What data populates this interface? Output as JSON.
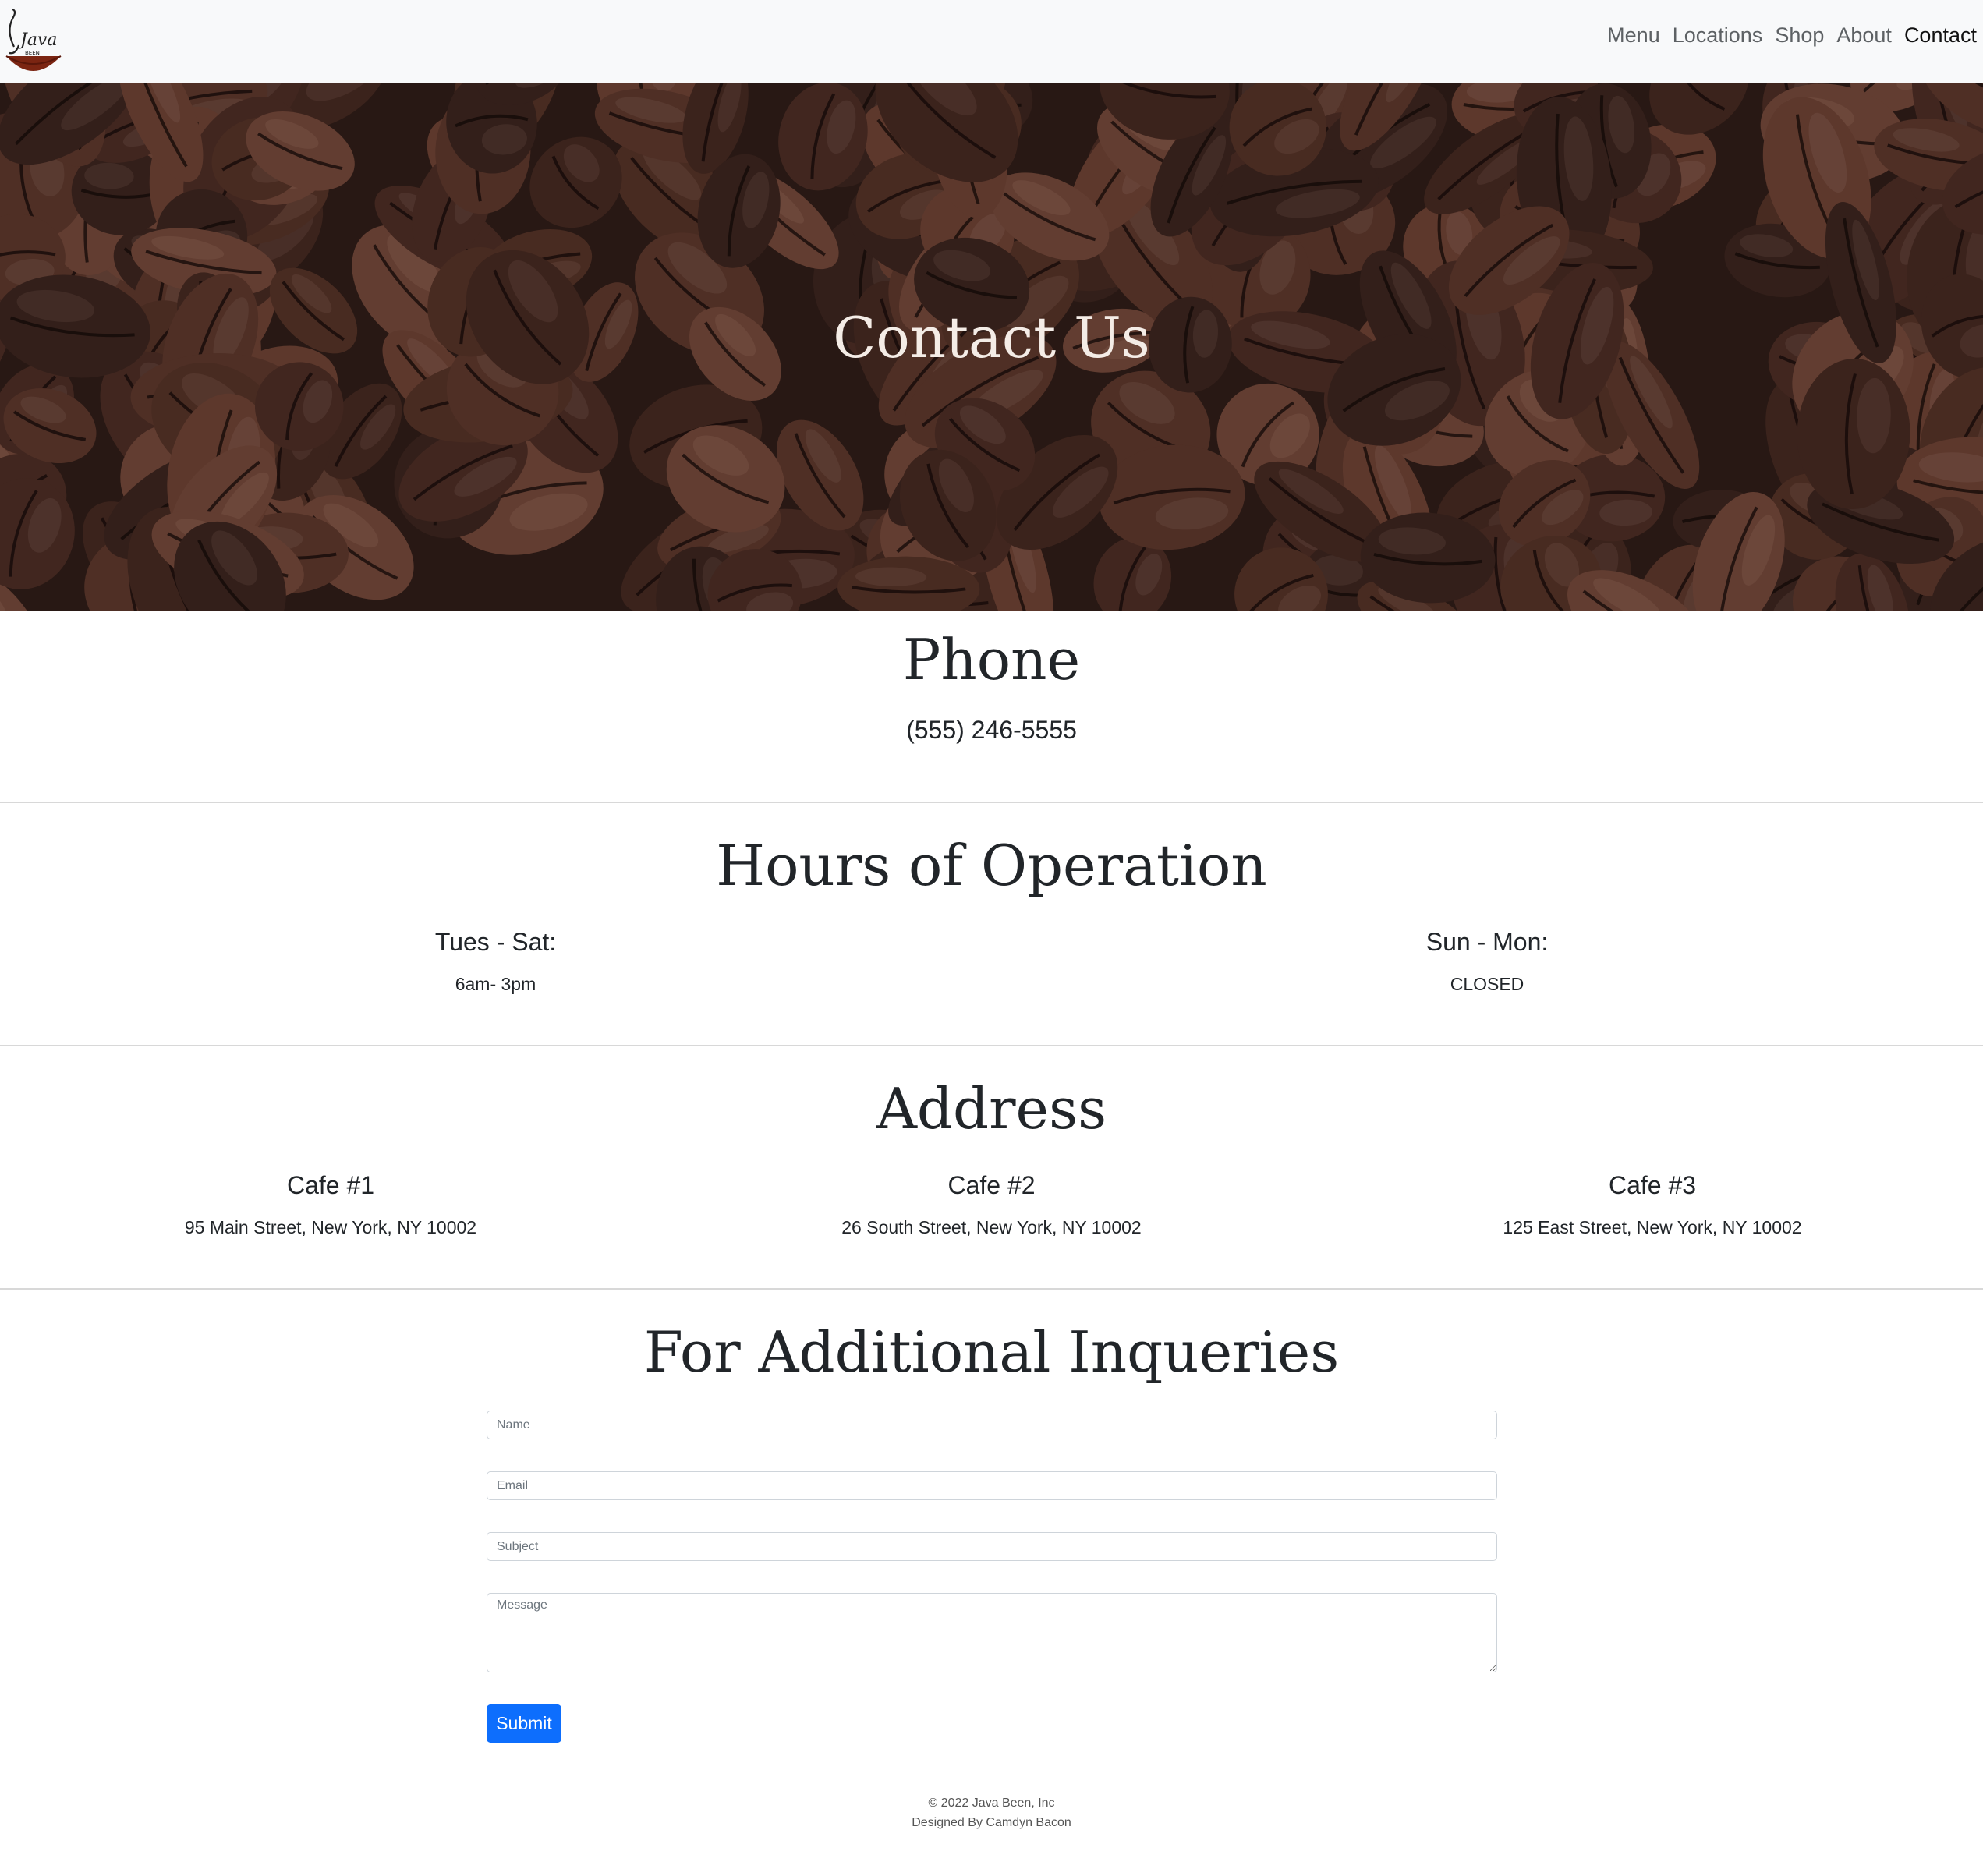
{
  "brand": {
    "name": "Java",
    "tagline": "BEEN",
    "accent_color": "#7b2512"
  },
  "nav": {
    "items": [
      {
        "label": "Menu",
        "active": false
      },
      {
        "label": "Locations",
        "active": false
      },
      {
        "label": "Shop",
        "active": false
      },
      {
        "label": "About",
        "active": false
      },
      {
        "label": "Contact",
        "active": true
      }
    ]
  },
  "hero": {
    "title": "Contact Us"
  },
  "phone": {
    "heading": "Phone",
    "number": "(555) 246-5555"
  },
  "hours": {
    "heading": "Hours of Operation",
    "blocks": [
      {
        "days": "Tues - Sat:",
        "time": "6am- 3pm"
      },
      {
        "days": "Sun - Mon:",
        "time": "CLOSED"
      }
    ]
  },
  "address": {
    "heading": "Address",
    "cafes": [
      {
        "name": "Cafe #1",
        "street": "95 Main Street, New York, NY 10002"
      },
      {
        "name": "Cafe #2",
        "street": "26 South Street, New York, NY 10002"
      },
      {
        "name": "Cafe #3",
        "street": "125 East Street, New York, NY 10002"
      }
    ]
  },
  "form": {
    "heading": "For Additional Inqueries",
    "name_placeholder": "Name",
    "email_placeholder": "Email",
    "subject_placeholder": "Subject",
    "message_placeholder": "Message",
    "submit_label": "Submit",
    "submit_color": "#0d6efd"
  },
  "footer": {
    "copyright": "© 2022 Java Been, Inc",
    "credit": "Designed By Camdyn Bacon"
  }
}
